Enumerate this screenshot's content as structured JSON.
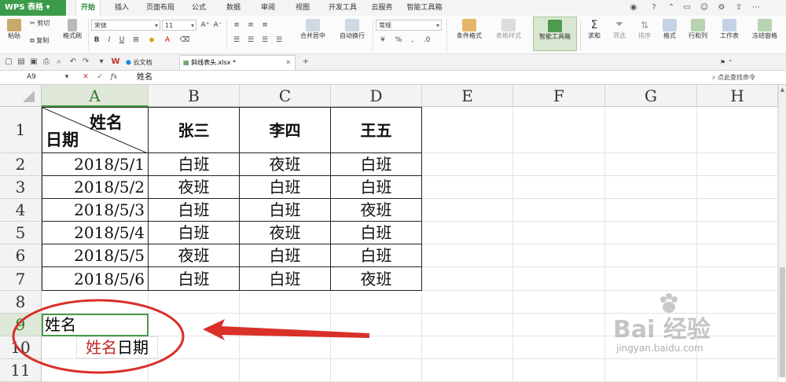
{
  "app": {
    "menu_label": "WPS 表格"
  },
  "ribbon_tabs": [
    "开始",
    "插入",
    "页面布局",
    "公式",
    "数据",
    "审阅",
    "视图",
    "开发工具",
    "云服务",
    "智能工具箱"
  ],
  "ribbon": {
    "paste": "粘贴",
    "cut": "剪切",
    "copy": "复制",
    "format_painter": "格式刷",
    "font_name": "宋体",
    "font_size": "11",
    "merge_center": "合并居中",
    "wrap_text": "自动换行",
    "number_format": "常规",
    "conditional_format": "条件格式",
    "table_style": "表格样式",
    "smart_toolbox": "智能工具箱",
    "sum": "求和",
    "filter": "筛选",
    "sort": "排序",
    "format": "格式",
    "row_col": "行和列",
    "worksheet": "工作表",
    "freeze": "冻结窗格"
  },
  "doc_tabs": {
    "cloud": "云文档",
    "file": "斜线表头.xlsx *"
  },
  "search_cmd": "点此查找命令",
  "formula_bar": {
    "name_box": "A9",
    "fx": "fx",
    "content": "姓名"
  },
  "columns": [
    "A",
    "B",
    "C",
    "D",
    "E",
    "F",
    "G",
    "H"
  ],
  "rows": [
    "1",
    "2",
    "3",
    "4",
    "5",
    "6",
    "7",
    "8",
    "9",
    "10",
    "11"
  ],
  "table": {
    "diag_top": "姓名",
    "diag_bottom": "日期",
    "headers": [
      "张三",
      "李四",
      "王五"
    ],
    "body": [
      [
        "2018/5/1",
        "白班",
        "夜班",
        "白班"
      ],
      [
        "2018/5/2",
        "夜班",
        "白班",
        "白班"
      ],
      [
        "2018/5/3",
        "白班",
        "白班",
        "夜班"
      ],
      [
        "2018/5/4",
        "白班",
        "夜班",
        "白班"
      ],
      [
        "2018/5/5",
        "夜班",
        "白班",
        "白班"
      ],
      [
        "2018/5/6",
        "白班",
        "白班",
        "夜班"
      ]
    ]
  },
  "active_cell_text": "姓名",
  "autocomplete": {
    "typed": "姓名",
    "rest": "日期"
  },
  "watermark": {
    "text": "Bai 经验",
    "url": "jingyan.baidu.com"
  },
  "colors": {
    "accent": "#3b9b4a",
    "annotation": "#d9302a"
  }
}
